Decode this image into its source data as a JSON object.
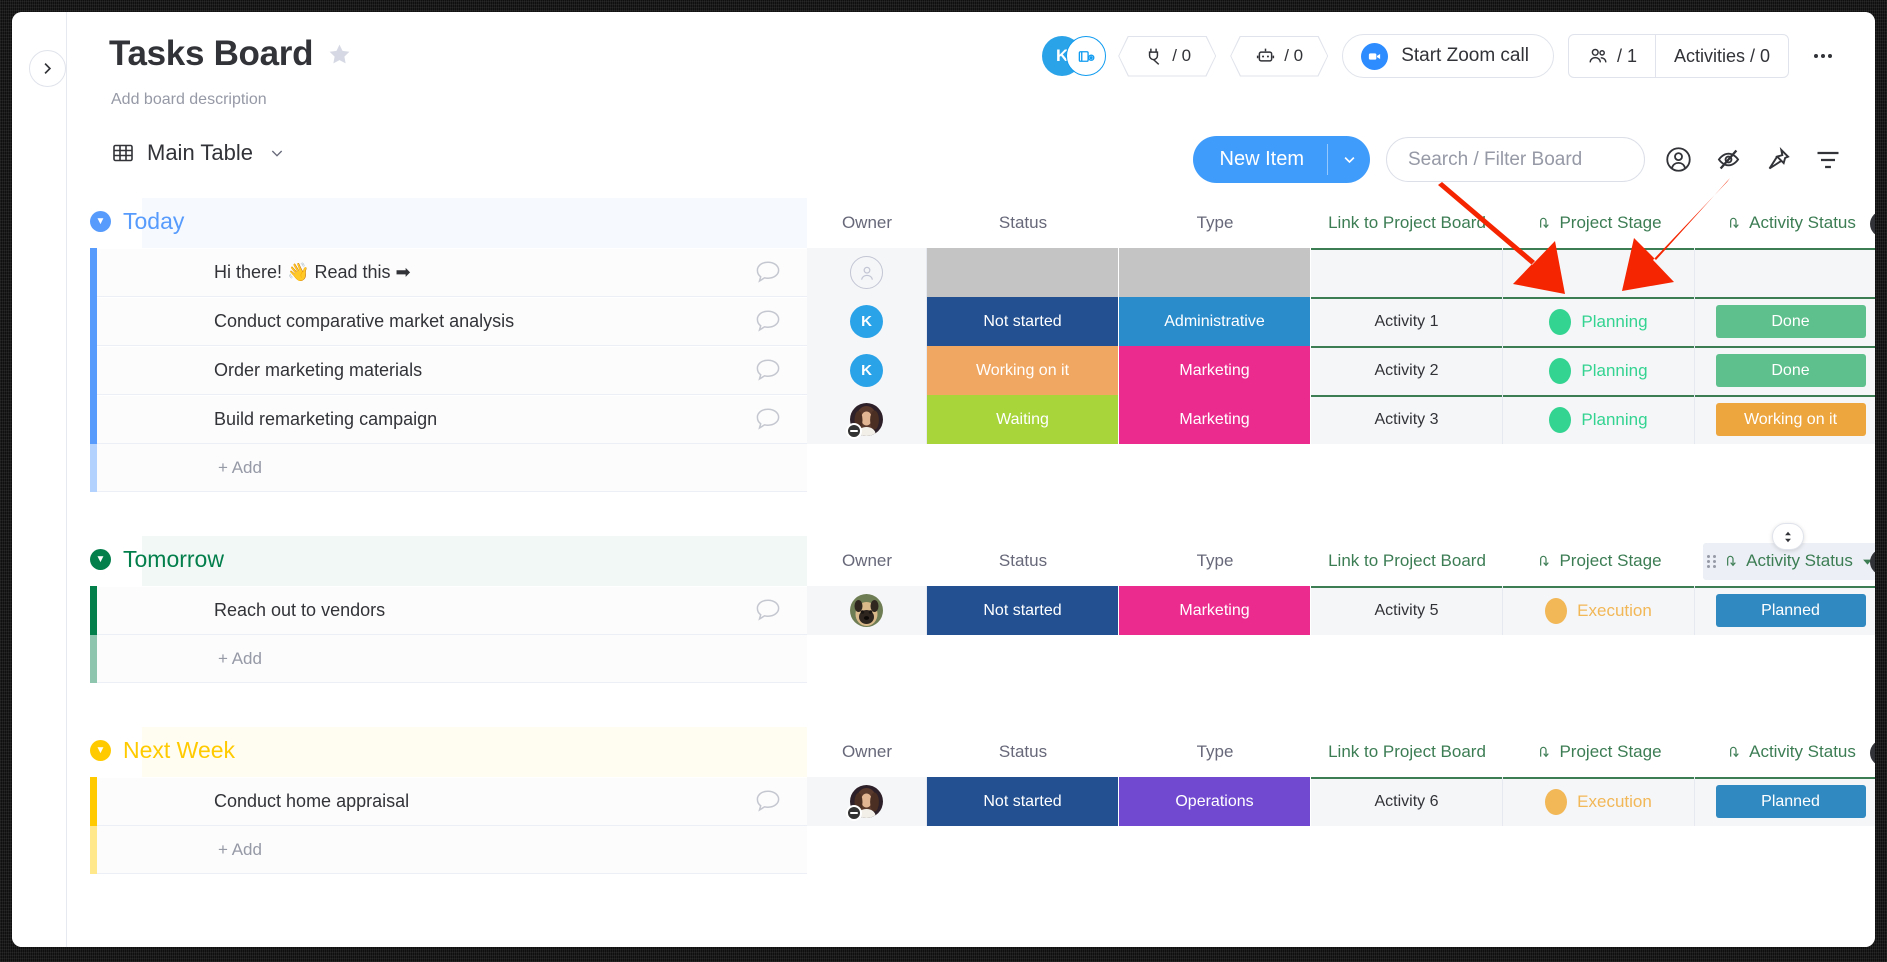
{
  "window": {
    "title": "Tasks Board"
  },
  "header": {
    "title": "Tasks Board",
    "description": "Add board description",
    "avatar_initial": "K",
    "integrations_count": "/ 0",
    "automations_count": "/ 0",
    "zoom_button": "Start Zoom call",
    "members_count": "/ 1",
    "activities_label": "Activities / 0",
    "more_label": "•••"
  },
  "viewbar": {
    "view_name": "Main Table",
    "caret": "⌄"
  },
  "toolbar": {
    "new_item": "New Item",
    "new_item_caret": "⌄",
    "search_placeholder": "Search / Filter Board",
    "search_value": ""
  },
  "columns": [
    "Owner",
    "Status",
    "Type",
    "Link to Project Board",
    "Project Stage",
    "Activity Status"
  ],
  "mirror_columns": [
    "Link to Project Board",
    "Project Stage",
    "Activity Status"
  ],
  "add_row_label": "+ Add",
  "groups": [
    {
      "name": "Today",
      "color": "#579bfc",
      "headers": [
        "Owner",
        "Status",
        "Type",
        "Link to Project Board",
        "Project Stage",
        "Activity Status"
      ],
      "rows": [
        {
          "name": "Hi there! 👋  Read this ➡",
          "owner": "none",
          "status": {
            "label": "",
            "color": "#c4c4c4"
          },
          "type": {
            "label": "",
            "color": "#c4c4c4"
          },
          "link": "",
          "stage": {
            "label": "",
            "color": ""
          },
          "activity": {
            "label": "",
            "color": ""
          }
        },
        {
          "name": "Conduct comparative market analysis",
          "owner": "K",
          "status": {
            "label": "Not started",
            "color": "#225091"
          },
          "type": {
            "label": "Administrative",
            "color": "#2b8ccc"
          },
          "link": "Activity 1",
          "stage": {
            "label": "Planning",
            "color": "#33d391"
          },
          "activity": {
            "label": "Done",
            "color": "#5dc08d"
          }
        },
        {
          "name": "Order marketing materials",
          "owner": "K",
          "status": {
            "label": "Working on it",
            "color": "#f0a762"
          },
          "type": {
            "label": "Marketing",
            "color": "#ec2b8e"
          },
          "link": "Activity 2",
          "stage": {
            "label": "Planning",
            "color": "#33d391"
          },
          "activity": {
            "label": "Done",
            "color": "#5dc08d"
          }
        },
        {
          "name": "Build remarketing campaign",
          "owner": "woman",
          "status": {
            "label": "Waiting",
            "color": "#a7d53a"
          },
          "type": {
            "label": "Marketing",
            "color": "#ec2b8e"
          },
          "link": "Activity 3",
          "stage": {
            "label": "Planning",
            "color": "#33d391"
          },
          "activity": {
            "label": "Working on it",
            "color": "#eda martin"
          }
        }
      ]
    },
    {
      "name": "Tomorrow",
      "color": "#037f4c",
      "rows": [
        {
          "name": "Reach out to vendors",
          "owner": "pug",
          "status": {
            "label": "Not started",
            "color": "#225091"
          },
          "type": {
            "label": "Marketing",
            "color": "#ec2b8e"
          },
          "link": "Activity 5",
          "stage": {
            "label": "Execution",
            "color": "#f2b757"
          },
          "activity": {
            "label": "Planned",
            "color": "#3089c0"
          }
        }
      ]
    },
    {
      "name": "Next Week",
      "color": "#ffcb00",
      "rows": [
        {
          "name": "Conduct home appraisal",
          "owner": "woman",
          "status": {
            "label": "Not started",
            "color": "#225091"
          },
          "type": {
            "label": "Operations",
            "color": "#7149d0"
          },
          "link": "Activity 6",
          "stage": {
            "label": "Execution",
            "color": "#f2b757"
          },
          "activity": {
            "label": "Planned",
            "color": "#3089c0"
          }
        }
      ]
    }
  ],
  "activity_status_colors": {
    "done": "#5dc08d",
    "working": "#eda53d",
    "planned": "#3089c0"
  },
  "accent": "#0073ea",
  "mirror_green": "#3c7d54"
}
